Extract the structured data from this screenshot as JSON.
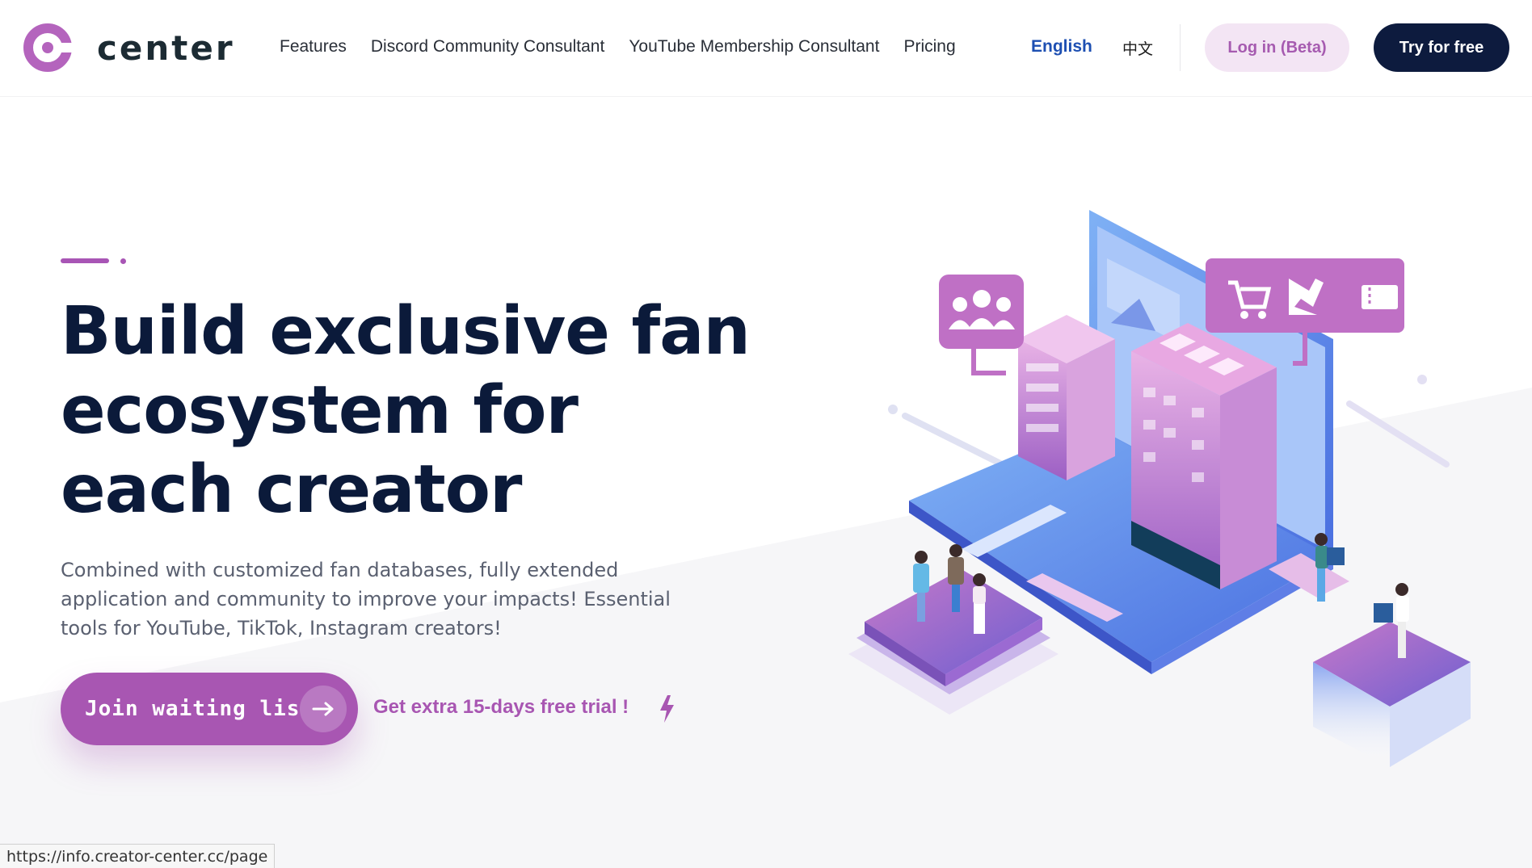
{
  "brand": {
    "name": "center",
    "accent": "#a856b2",
    "navy": "#0d1b3e"
  },
  "nav": {
    "items": [
      {
        "label": "Features"
      },
      {
        "label": "Discord Community Consultant"
      },
      {
        "label": "YouTube Membership Consultant"
      },
      {
        "label": "Pricing"
      }
    ],
    "lang_en": "English",
    "lang_zh": "中文",
    "login_label": "Log in (Beta)",
    "try_label": "Try for free"
  },
  "hero": {
    "title_lines": [
      "Build exclusive fan",
      "ecosystem for",
      "each creator"
    ],
    "description": "Combined with customized fan databases, fully extended application and community to improve your impacts! Essential tools for YouTube, TikTok, Instagram creators!",
    "cta_label": "Join waiting list",
    "cta_icon": "arrow-right-icon",
    "trial_text": "Get extra 15-days free trial !",
    "trial_icon": "lightning-bolt-icon"
  },
  "illustration": {
    "icons": [
      "group-users-icon",
      "shopping-cart-icon",
      "robot-arm-icon",
      "ticket-icon"
    ]
  },
  "status_bar": {
    "url": "https://info.creator-center.cc/page"
  }
}
